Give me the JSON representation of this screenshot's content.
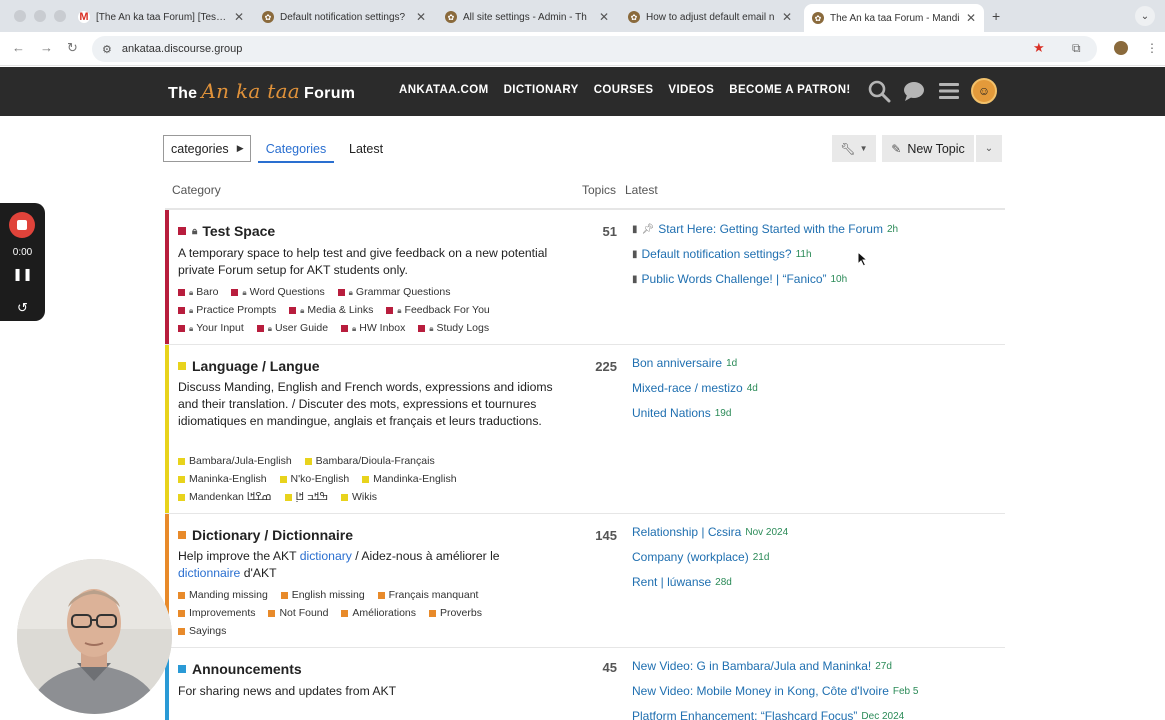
{
  "browser": {
    "tabs": [
      {
        "title": "[The An ka taa Forum] [Test S",
        "favicon": "gmail-icon"
      },
      {
        "title": "Default notification settings?",
        "favicon": "discourse-icon"
      },
      {
        "title": "All site settings - Admin - Th",
        "favicon": "discourse-icon"
      },
      {
        "title": "How to adjust default email n",
        "favicon": "discourse-icon"
      },
      {
        "title": "The An ka taa Forum - Mandi",
        "favicon": "discourse-icon",
        "active": true
      }
    ],
    "url": "ankataa.discourse.group"
  },
  "site": {
    "logo_pre": "The",
    "logo_mid": "An ka taa",
    "logo_post": "Forum",
    "nav": [
      "ANKATAA.COM",
      "DICTIONARY",
      "COURSES",
      "VIDEOS",
      "BECOME A PATRON!"
    ]
  },
  "controls": {
    "dropdown_label": "categories",
    "tabs": [
      "Categories",
      "Latest"
    ],
    "new_topic": "New Topic"
  },
  "table": {
    "headers": {
      "category": "Category",
      "topics": "Topics",
      "latest": "Latest"
    }
  },
  "categories": [
    {
      "name": "Test Space",
      "color": "#b81d3d",
      "locked": true,
      "description": "A temporary space to help test and give feedback on a new potential private Forum setup for AKT students only.",
      "topics": "51",
      "subcategories": [
        [
          "Baro",
          "Word Questions",
          "Grammar Questions"
        ],
        [
          "Practice Prompts",
          "Media & Links",
          "Feedback For You"
        ],
        [
          "Your Input",
          "User Guide",
          "HW Inbox",
          "Study Logs"
        ]
      ],
      "latest": [
        {
          "title": "Start Here: Getting Started with the Forum",
          "age": "2h",
          "pinned": true
        },
        {
          "title": "Default notification settings?",
          "age": "11h"
        },
        {
          "title": "Public Words Challenge! | “Fanico”",
          "age": "10h"
        }
      ]
    },
    {
      "name": "Language / Langue",
      "color": "#e8d31c",
      "description": "Discuss Manding, English and French words, expressions and idioms and their translation. / Discuter des mots, expressions et tournures idiomatiques en mandingue, anglais et français et leurs traductions.",
      "topics": "225",
      "subcategories": [
        [
          "Bambara/Jula-English",
          "Bambara/Dioula-Français"
        ],
        [
          "Maninka-English",
          "N'ko-English",
          "Mandinka-English"
        ],
        [
          "Mandenkan ߘߐߞߊ",
          "ߒߞߏ ߞߊ߲",
          "Wikis"
        ]
      ],
      "latest": [
        {
          "title": "Bon anniversaire",
          "age": "1d"
        },
        {
          "title": "Mixed-race / mestizo",
          "age": "4d"
        },
        {
          "title": "United Nations",
          "age": "19d"
        }
      ]
    },
    {
      "name": "Dictionary / Dictionnaire",
      "color": "#e88a2a",
      "description_parts": [
        "Help improve the AKT ",
        "dictionary",
        " / Aidez-nous à améliorer le ",
        "dictionnaire",
        " d'AKT"
      ],
      "topics": "145",
      "subcategories": [
        [
          "Manding missing",
          "English missing",
          "Français manquant"
        ],
        [
          "Improvements",
          "Not Found",
          "Améliorations",
          "Proverbs"
        ],
        [
          "Sayings"
        ]
      ],
      "latest": [
        {
          "title": "Relationship | Cɛsira",
          "age": "Nov 2024"
        },
        {
          "title": "Company (workplace)",
          "age": "21d"
        },
        {
          "title": "Rent | lúwanse",
          "age": "28d"
        }
      ]
    },
    {
      "name": "Announcements",
      "color": "#2a9ad6",
      "description": "For sharing news and updates from AKT",
      "topics": "45",
      "latest": [
        {
          "title": "New Video: G in Bambara/Jula and Maninka!",
          "age": "27d"
        },
        {
          "title": "New Video: Mobile Money in Kong, Côte d'Ivoire",
          "age": "Feb 5"
        },
        {
          "title": "Platform Enhancement: “Flashcard Focus”",
          "age": "Dec 2024"
        }
      ]
    }
  ],
  "recorder": {
    "time": "0:00"
  }
}
